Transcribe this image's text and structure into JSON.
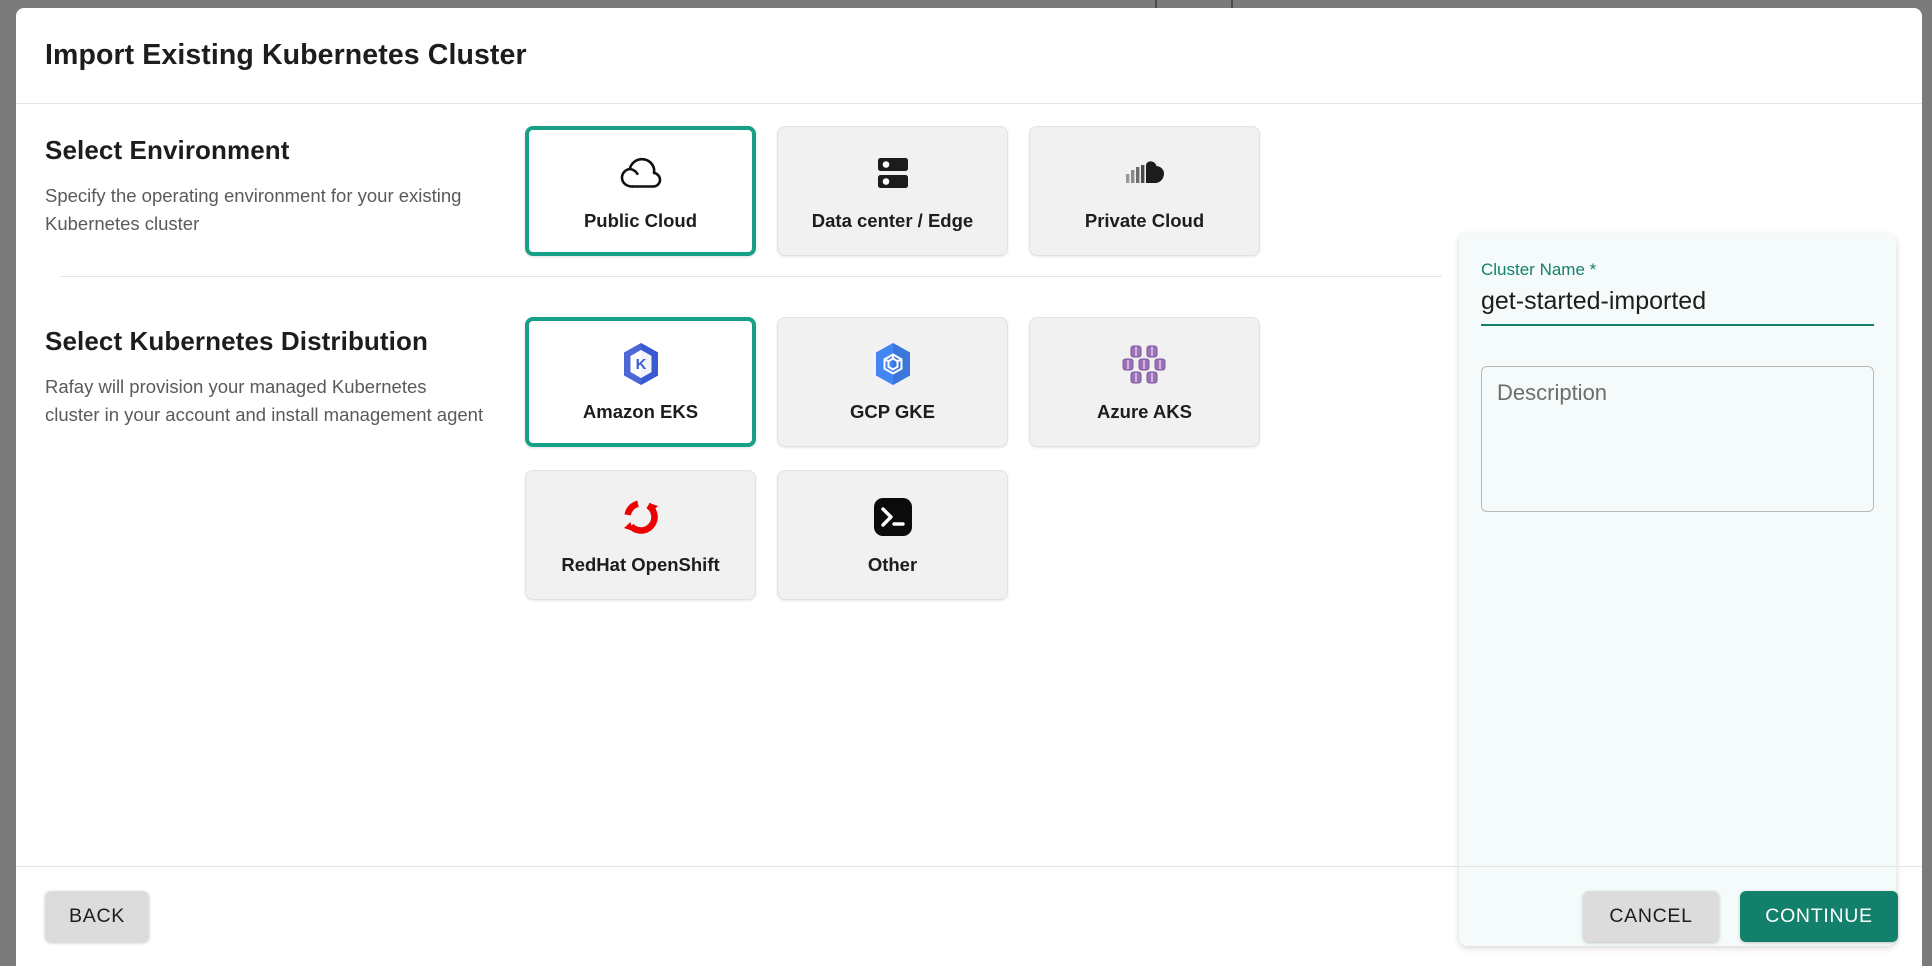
{
  "dialog": {
    "title": "Import Existing Kubernetes Cluster"
  },
  "sections": [
    {
      "title": "Select Environment",
      "description": "Specify the operating environment for your existing Kubernetes cluster",
      "options": [
        {
          "label": "Public Cloud",
          "icon": "cloud-outline-icon",
          "selected": true
        },
        {
          "label": "Data center / Edge",
          "icon": "server-rack-icon",
          "selected": false
        },
        {
          "label": "Private Cloud",
          "icon": "soundcloud-cloud-icon",
          "selected": false
        }
      ]
    },
    {
      "title": "Select Kubernetes Distribution",
      "description": "Rafay will provision your managed Kubernetes cluster in your account and install management agent",
      "options": [
        {
          "label": "Amazon EKS",
          "icon": "amazon-eks-icon",
          "selected": true
        },
        {
          "label": "GCP GKE",
          "icon": "gcp-gke-icon",
          "selected": false
        },
        {
          "label": "Azure AKS",
          "icon": "azure-aks-icon",
          "selected": false
        },
        {
          "label": "RedHat OpenShift",
          "icon": "redhat-openshift-icon",
          "selected": false
        },
        {
          "label": "Other",
          "icon": "terminal-icon",
          "selected": false
        }
      ]
    }
  ],
  "form": {
    "cluster_name_label": "Cluster Name *",
    "cluster_name_value": "get-started-imported",
    "cluster_name_placeholder": "Cluster Name",
    "description_placeholder": "Description",
    "description_value": ""
  },
  "footer": {
    "back_label": "BACK",
    "cancel_label": "CANCEL",
    "continue_label": "CONTINUE"
  },
  "colors": {
    "accent": "#16a085",
    "primary_button": "#13806c",
    "label_green": "#16806c",
    "panel_bg": "#f4fbfa",
    "card_bg": "#f1f1f1",
    "backdrop": "#7b7b7b"
  }
}
